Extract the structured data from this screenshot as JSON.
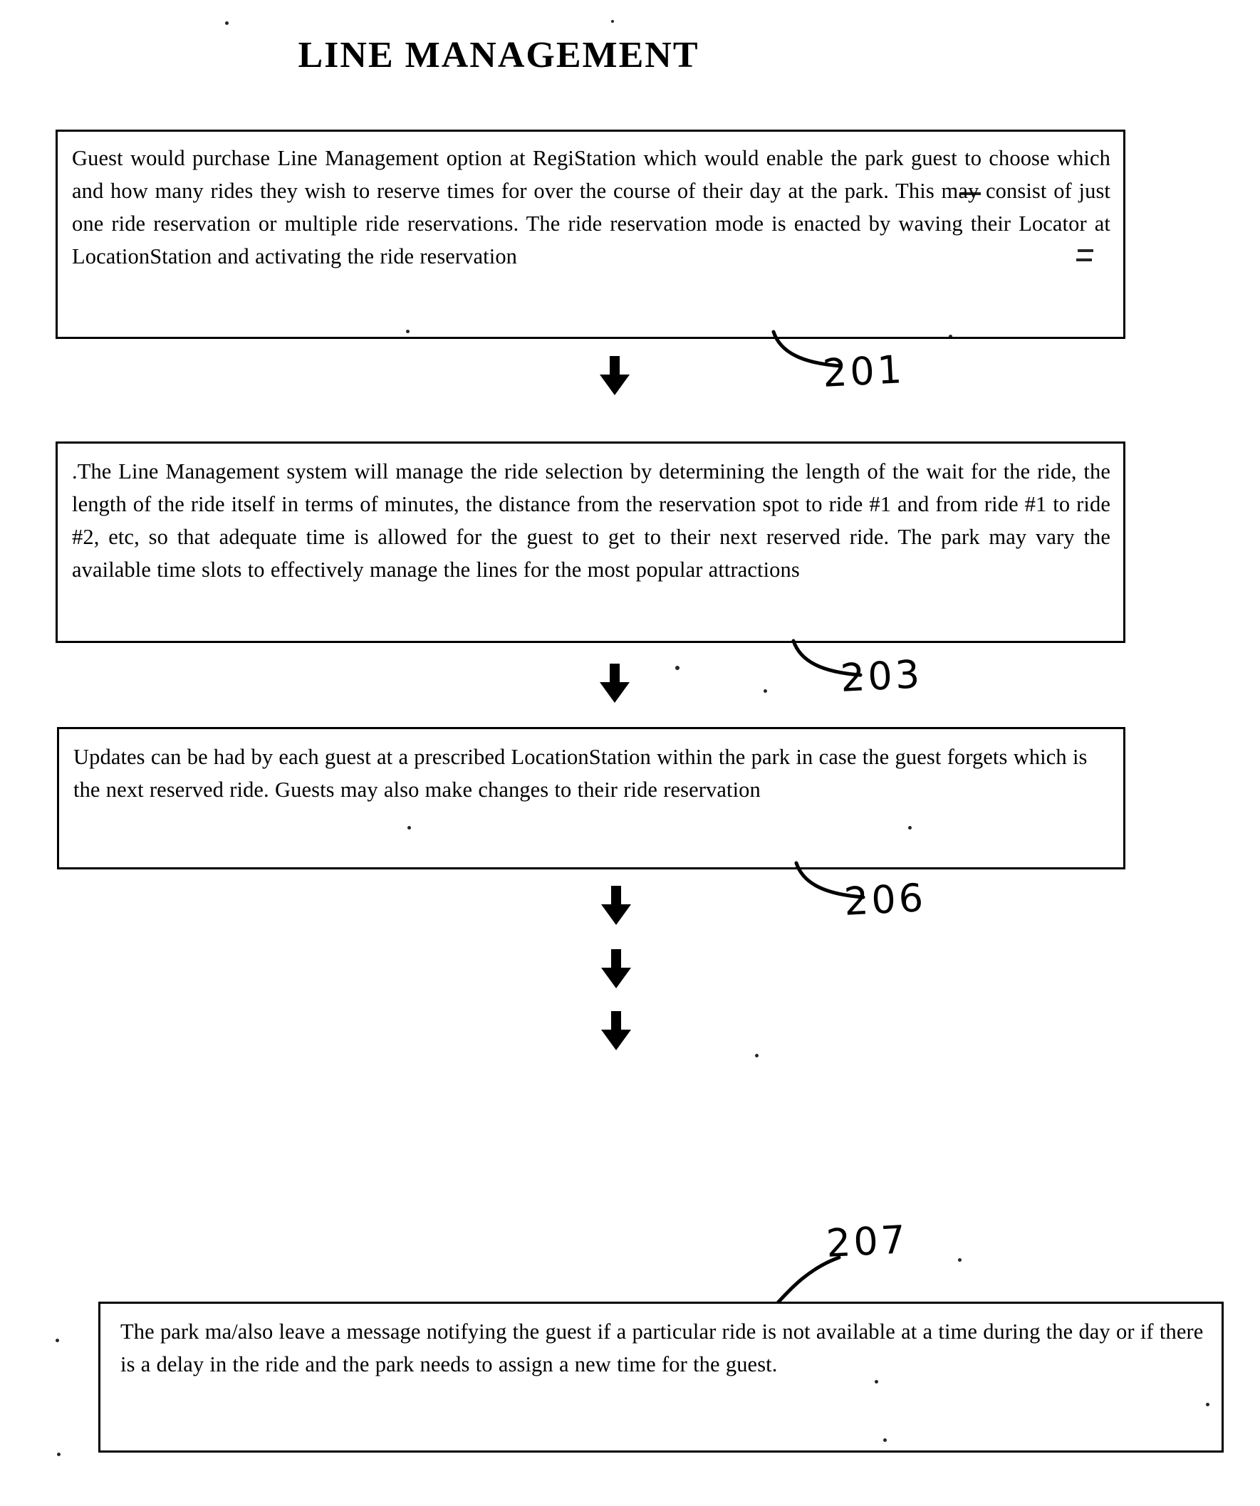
{
  "document": {
    "title": "LINE MANAGEMENT"
  },
  "flow": {
    "steps": [
      {
        "ref": "201",
        "text": "Guest would purchase Line Management option at RegiStation which would enable the park guest to choose which and how many rides they wish to reserve times for over the course of their day at the park.  This may consist of just one ride reservation or multiple ride reservations.  The ride reservation mode is enacted by waving their Locator at LocationStation and activating the ride reservation"
      },
      {
        "ref": "203",
        "text": ".The Line Management system will manage the ride selection by determining the length of the wait for the ride, the length of the ride itself in terms of minutes, the distance from the reservation spot to  ride #1 and from ride #1 to ride #2, etc, so that adequate time is allowed for the guest to get to their next reserved ride.  The park may vary the available time slots to effectively manage the lines for the most popular attractions"
      },
      {
        "ref": "206",
        "text": "Updates can be had by each guest at a prescribed LocationStation within the park in case the guest forgets which is the next reserved ride. Guests may also make changes to their ride reservation"
      },
      {
        "ref": "207",
        "text": "The park ma/also leave a message notifying the guest if a particular ride is not available at a time during the day or if there is a delay in the ride and the park needs to assign a new time for the guest."
      }
    ],
    "arrow_icons": [
      "down-arrow-icon",
      "down-arrow-icon",
      "down-arrow-icon",
      "down-arrow-icon",
      "down-arrow-icon"
    ]
  },
  "colors": {
    "ink": "#000000",
    "paper": "#ffffff"
  }
}
